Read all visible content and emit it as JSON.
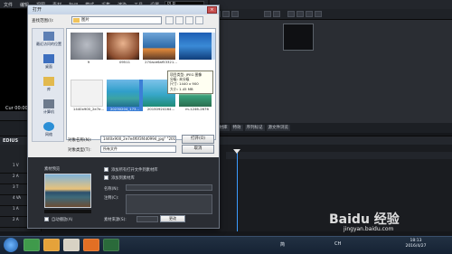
{
  "player": {
    "menus": [
      "文件",
      "编辑",
      "视图",
      "素材",
      "标记",
      "模式",
      "采集",
      "渲染",
      "工具",
      "设置",
      "帮助"
    ],
    "badge": "PLR",
    "timecode": "Cur 00:00:00;00"
  },
  "bin": {
    "tabs": [
      "素材库",
      "特效",
      "序列标记",
      "源文件浏览"
    ]
  },
  "timeline": {
    "label": "EDIUS",
    "tracks": [
      "1 V",
      "2 A",
      "3 T",
      "4 VA",
      "1 A",
      "2 A"
    ]
  },
  "dialog": {
    "title": "打开",
    "lookin_label": "查找范围(I):",
    "lookin_value": "图片",
    "places": [
      "最近访问的位置",
      "桌面",
      "库",
      "计算机",
      "网络"
    ],
    "files": [
      {
        "name": "9"
      },
      {
        "name": "09511"
      },
      {
        "name": "270ace6af53321..."
      },
      {
        "name": ""
      },
      {
        "name": "1440x900_2e7e..."
      },
      {
        "name": "20230204_173..."
      },
      {
        "name": "20150924164..."
      },
      {
        "name": "m-1246-2676"
      }
    ],
    "tooltip": {
      "line1": "项目类型: JPEG 图像",
      "line2": "分级: 未分级",
      "line3": "尺寸: 1440 x 900",
      "line4": "大小: 1.45 MB"
    },
    "filename_label": "对象名称(N):",
    "filename_value": "1440x900_2e7e4f6f3f4d0994_jpg\" \"2016...",
    "filetype_label": "对象类型(T):",
    "filetype_value": "所有文件",
    "open_button": "打开(O)",
    "cancel_button": "取消",
    "lower": {
      "preview_label": "素材预览",
      "chk_all": "添加所有打开文件到素材库",
      "chk_sub": "添加到素材库",
      "name_label": "名称(N):",
      "comment_label": "注释(C):",
      "reel_label": "素材来源(S):",
      "reel_btn": "更改",
      "auto_label": "自动播放(A)"
    }
  },
  "taskbar": {
    "time": "18:13",
    "date": "2016/4/27",
    "tray": "简",
    "tray2": "CH"
  },
  "watermark": {
    "text": "Baidu 经验",
    "sub": "jingyan.baidu.com"
  }
}
